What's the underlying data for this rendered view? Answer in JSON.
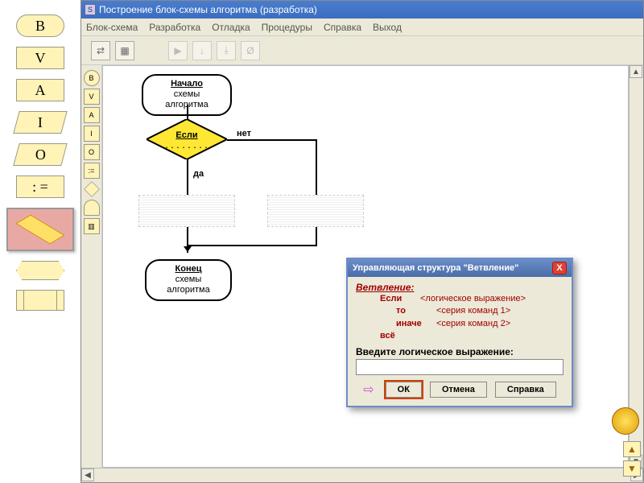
{
  "palette": {
    "B": "B",
    "V": "V",
    "A": "A",
    "I": "I",
    "O": "O",
    "assign": ": ="
  },
  "app": {
    "title": "Построение блок-схемы алгоритма (разработка)",
    "menu": [
      "Блок-схема",
      "Разработка",
      "Отладка",
      "Процедуры",
      "Справка",
      "Выход"
    ]
  },
  "flow": {
    "start_l1": "Начало",
    "start_l2": "схемы алгоритма",
    "if_label": "Если",
    "if_dots": ". . . . . . . .",
    "yes": "да",
    "no": "нет",
    "end_l1": "Конец",
    "end_l2": "схемы алгоритма"
  },
  "dialog": {
    "title": "Управляющая структура  \"Ветвление\"",
    "heading": "Ветвление:",
    "kw_if": "Если",
    "arg_if": "<логическое выражение>",
    "kw_then": "то",
    "arg_then": "<серия команд 1>",
    "kw_else": "иначе",
    "arg_else": "<серия команд 2>",
    "kw_end": "всё",
    "prompt": "Введите логическое выражение:",
    "input_value": "",
    "ok": "ОК",
    "cancel": "Отмена",
    "help": "Справка"
  }
}
